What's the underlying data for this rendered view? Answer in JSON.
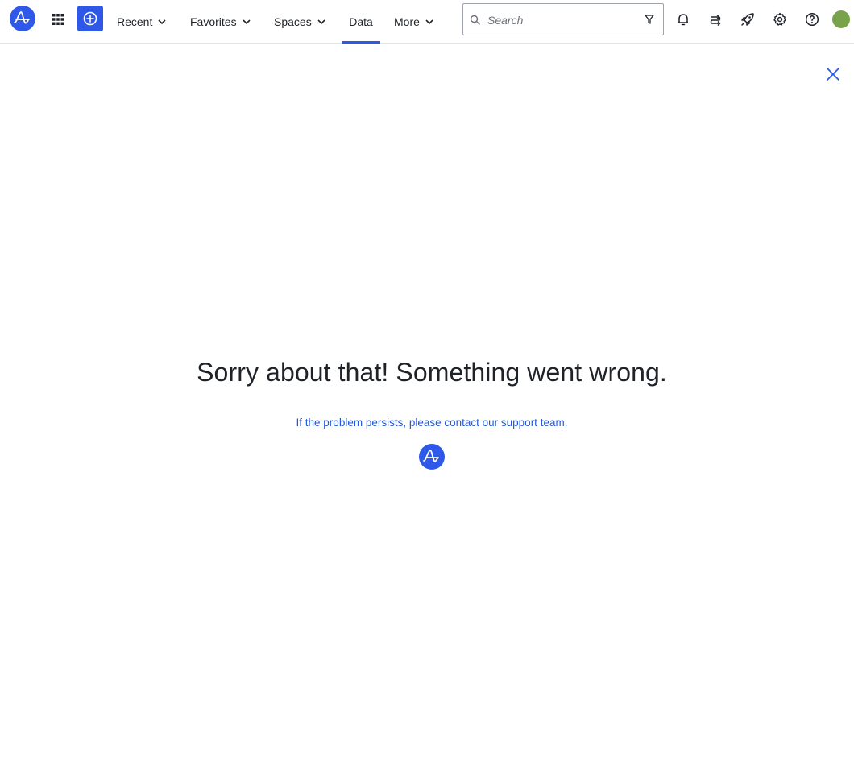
{
  "header": {
    "nav": [
      {
        "label": "Recent",
        "has_dropdown": true
      },
      {
        "label": "Favorites",
        "has_dropdown": true
      },
      {
        "label": "Spaces",
        "has_dropdown": true
      },
      {
        "label": "Data",
        "has_dropdown": false,
        "active": true
      },
      {
        "label": "More",
        "has_dropdown": true
      }
    ],
    "search": {
      "placeholder": "Search",
      "value": ""
    },
    "icons": [
      "app-logo",
      "apps-grid-icon",
      "create-plus-icon",
      "search-icon",
      "filter-icon",
      "bell-icon",
      "switch-arrows-icon",
      "rocket-icon",
      "gear-icon",
      "help-icon",
      "avatar"
    ],
    "accent_color": "#2e59e8",
    "avatar_color": "#79a34a"
  },
  "error": {
    "title": "Sorry about that! Something went wrong.",
    "support_text": "If the problem persists, please contact our support team.",
    "close_icon": "close-icon"
  }
}
